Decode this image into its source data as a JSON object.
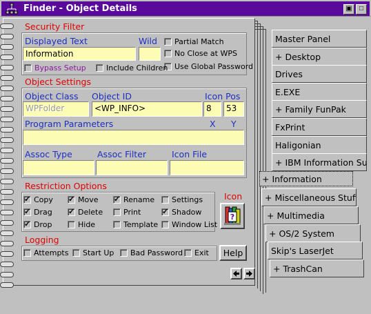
{
  "window": {
    "title": "Finder - Object Details"
  },
  "security": {
    "title": "Security Filter",
    "displayed_text_label": "Displayed Text",
    "wild_label": "Wild",
    "displayed_text_value": "Information",
    "wild_value": "",
    "partial_match": "Partial Match",
    "no_close": "No Close at WPS",
    "use_global_password": "Use Global Password",
    "bypass_setup": "Bypass Setup",
    "include_children": "Include Children"
  },
  "object_settings": {
    "title": "Object Settings",
    "object_class_label": "Object Class",
    "object_id_label": "Object ID",
    "icon_pos_label": "Icon Pos",
    "object_class_value": "WPFolder",
    "object_id_value": "<WP_INFO>",
    "icon_x_value": "8",
    "icon_y_value": "53",
    "program_parameters_label": "Program Parameters",
    "x_label": "X",
    "y_label": "Y",
    "assoc_type_label": "Assoc Type",
    "assoc_filter_label": "Assoc Filter",
    "icon_file_label": "Icon File"
  },
  "restriction": {
    "title": "Restriction Options",
    "icon_label": "Icon",
    "options": [
      {
        "label": "Copy",
        "checked": true
      },
      {
        "label": "Move",
        "checked": true
      },
      {
        "label": "Rename",
        "checked": true
      },
      {
        "label": "Settings",
        "checked": false
      },
      {
        "label": "Drag",
        "checked": true
      },
      {
        "label": "Delete",
        "checked": true
      },
      {
        "label": "Print",
        "checked": false
      },
      {
        "label": "Shadow",
        "checked": true
      },
      {
        "label": "Drop",
        "checked": true
      },
      {
        "label": "Hide",
        "checked": false
      },
      {
        "label": "Template",
        "checked": false
      },
      {
        "label": "Window List",
        "checked": false
      }
    ]
  },
  "logging": {
    "title": "Logging",
    "attempts": "Attempts",
    "start_up": "Start Up",
    "bad_password": "Bad Password",
    "exit": "Exit"
  },
  "help_label": "Help",
  "tabs": [
    "Master Panel",
    "+ Desktop",
    "Drives",
    "E.EXE",
    "+ Family FunPak",
    "FxPrint",
    "Haligonian",
    "+ IBM Information  Sup",
    "+ Information",
    "+ Miscellaneous Stuff",
    "+ Multimedia",
    "+ OS/2 System",
    "Skip's LaserJet",
    "+ TrashCan"
  ],
  "colors": {
    "title_bar": "#5a0a9a",
    "group_title": "#e00000",
    "field_label": "#1c2fbf",
    "field_bg": "#fcfcb4"
  },
  "icons": [
    "folder-tree-icon",
    "restore-icon",
    "maximize-icon",
    "folder-info-icon",
    "prev-arrow-icon",
    "next-arrow-icon"
  ]
}
